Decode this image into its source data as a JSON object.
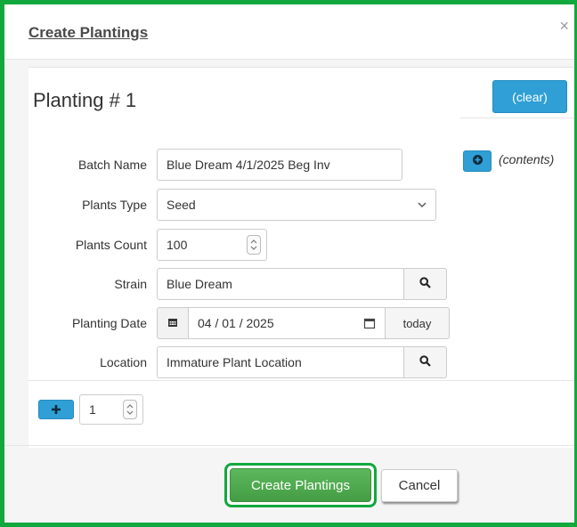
{
  "dialog": {
    "title": "Create Plantings",
    "close_glyph": "×"
  },
  "planting": {
    "label": "Planting #",
    "number": "1",
    "clear_label": "(clear)"
  },
  "form": {
    "batch_name": {
      "label": "Batch Name",
      "value": "Blue Dream 4/1/2025 Beg Inv"
    },
    "plants_type": {
      "label": "Plants Type",
      "value": "Seed"
    },
    "plants_count": {
      "label": "Plants Count",
      "value": "100"
    },
    "strain": {
      "label": "Strain",
      "value": "Blue Dream"
    },
    "planting_date": {
      "label": "Planting Date",
      "value": "04 / 01 / 2025",
      "today_label": "today"
    },
    "location": {
      "label": "Location",
      "value": "Immature Plant Location"
    }
  },
  "contents": {
    "label": "(contents)"
  },
  "add_rows": {
    "count": "1"
  },
  "footer": {
    "create_label": "Create Plantings",
    "cancel_label": "Cancel"
  },
  "colors": {
    "frame": "#12a83d",
    "accent": "#2f9fd5",
    "create": "#5cb85c"
  },
  "icons": [
    "close-icon",
    "chevron-down-icon",
    "spinner-icon",
    "search-icon",
    "calendar-icon",
    "plus-icon"
  ]
}
